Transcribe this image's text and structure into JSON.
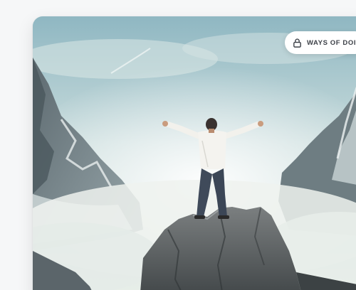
{
  "badge": {
    "label": "WAYS OF DOI",
    "icon": "lock-icon"
  },
  "colors": {
    "page_background": "#f6f7f8",
    "badge_background": "#ffffff",
    "badge_text": "#3d4148"
  }
}
